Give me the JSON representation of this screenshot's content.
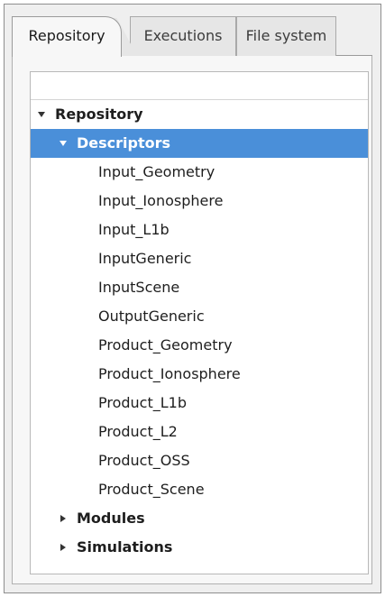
{
  "tabs": [
    {
      "label": "Repository",
      "active": true
    },
    {
      "label": "Executions",
      "active": false
    },
    {
      "label": "File system",
      "active": false
    }
  ],
  "tree": {
    "root": {
      "label": "Repository",
      "expanded": true
    },
    "descriptors": {
      "label": "Descriptors",
      "expanded": true,
      "selected": true,
      "children": [
        "Input_Geometry",
        "Input_Ionosphere",
        "Input_L1b",
        "InputGeneric",
        "InputScene",
        "OutputGeneric",
        "Product_Geometry",
        "Product_Ionosphere",
        "Product_L1b",
        "Product_L2",
        "Product_OSS",
        "Product_Scene"
      ]
    },
    "modules": {
      "label": "Modules",
      "expanded": false
    },
    "simulations": {
      "label": "Simulations",
      "expanded": false
    }
  },
  "colors": {
    "selection": "#4a8fd9",
    "background": "#ffffff",
    "panel": "#f7f7f7"
  }
}
